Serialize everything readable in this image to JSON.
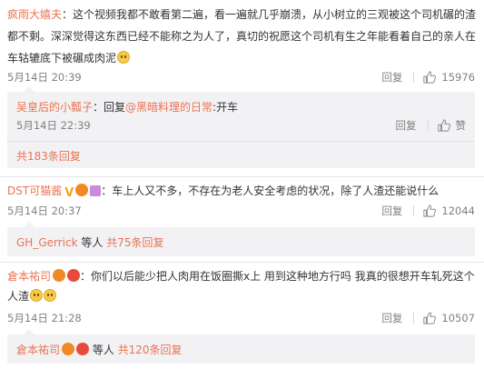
{
  "comments": [
    {
      "user": "疯雨大嬉夫",
      "text_lines": [
        "这个视频我都不敢看第二遍，看一遍就几乎崩溃，从小树立的三观被这个司机碾的渣",
        "都不剩。深深觉得这东西已经不能称之为人了，真切的祝愿这个司机有生之年能看着自己的亲人在",
        "车轱辘底下被碾成肉泥"
      ],
      "time": "5月14日 20:39",
      "reply_label": "回复",
      "likes": "15976",
      "sub_reply": {
        "user": "吴皇后的小瓢子",
        "prefix": "：回复",
        "mention": "@黑暗料理的日常",
        "text": ":开车",
        "time": "5月14日 22:39",
        "reply_label": "回复",
        "likes": "赞"
      },
      "more": "共183条回复"
    },
    {
      "user": "DST可猫酱",
      "text": "：车上人又不多，不存在为老人安全考虑的状况，除了人渣还能说什么",
      "time": "5月14日 20:37",
      "reply_label": "回复",
      "likes": "12044",
      "more_user": "GH_Gerrick",
      "more_mid": " 等人 ",
      "more": "共75条回复"
    },
    {
      "user": "倉本祐司",
      "text_lines": [
        "：你们以后能少把人肉用在饭圈撕x上 用到这种地方行吗 我真的很想开车轧死这个",
        "人渣"
      ],
      "time": "5月14日 21:28",
      "reply_label": "回复",
      "likes": "10507",
      "more_user": "倉本祐司",
      "more_mid": " 等人 ",
      "more": "共120条回复"
    }
  ],
  "colors": {
    "accent": "#eb7350",
    "meta": "#808080",
    "reply_bg": "#f2f2f5"
  }
}
